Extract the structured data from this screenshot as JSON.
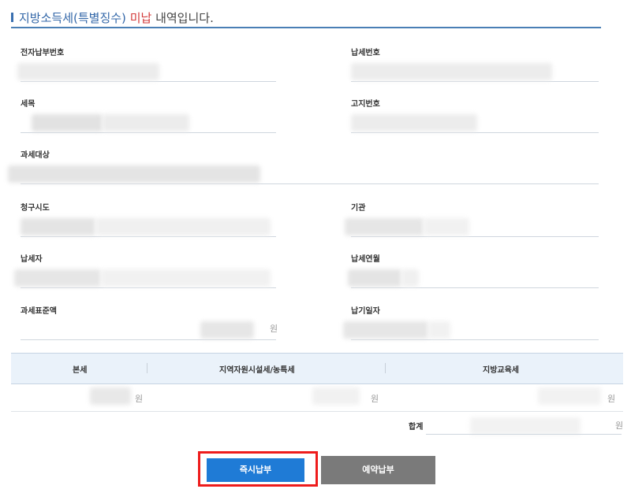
{
  "title": {
    "part1": "지방소득세(특별징수) ",
    "part2": "미납",
    "part3": " 내역입니다."
  },
  "fields": {
    "e_payment_no": "전자납부번호",
    "tax_no": "납세번호",
    "tax_item": "세목",
    "notice_no": "고지번호",
    "tax_target": "과세대상",
    "billing_city": "청구시도",
    "institution": "기관",
    "taxpayer": "납세자",
    "tax_year_month": "납세연월",
    "tax_base_amount": "과세표준액",
    "due_date": "납기일자"
  },
  "currency_unit": "원",
  "table": {
    "headers": [
      "본세",
      "지역자원시설세/농특세",
      "지방교육세"
    ],
    "row_units": [
      "원",
      "원",
      "원"
    ]
  },
  "total_label": "합계",
  "buttons": {
    "pay_now": "즉시납부",
    "reserve_pay": "예약납부"
  }
}
